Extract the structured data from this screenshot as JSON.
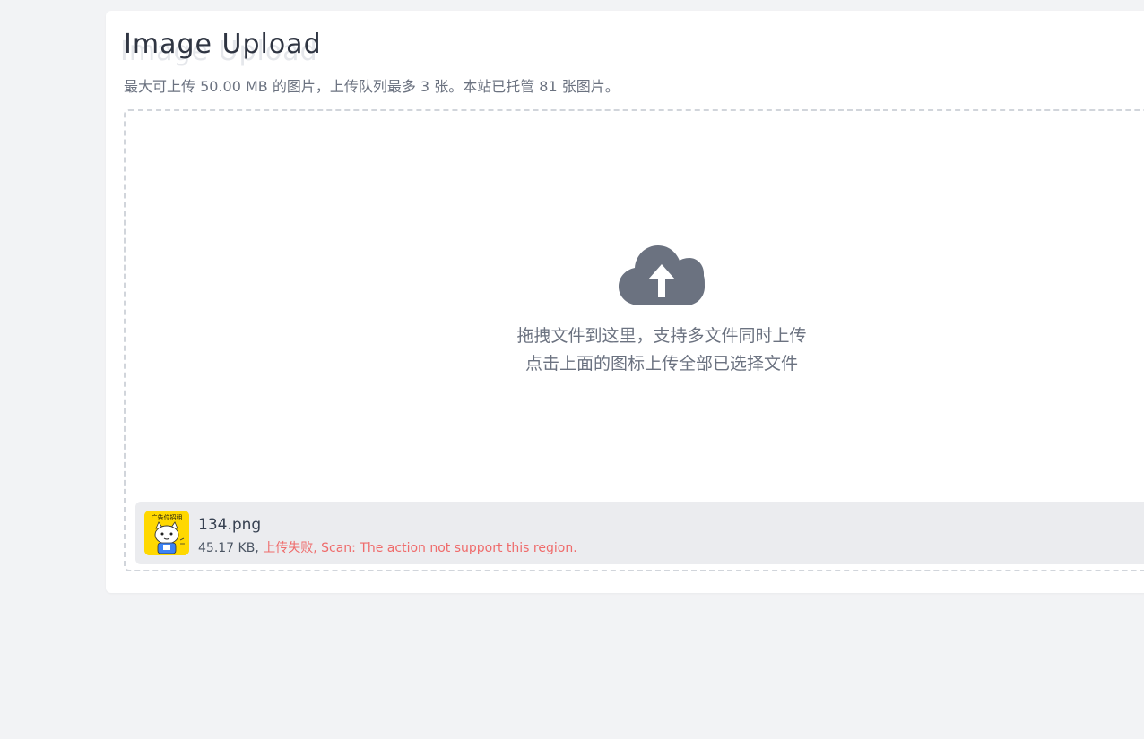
{
  "page": {
    "title": "Image Upload",
    "subtitle": "最大可上传 50.00 MB 的图片，上传队列最多 3 张。本站已托管 81 张图片。"
  },
  "dropzone": {
    "line1": "拖拽文件到这里，支持多文件同时上传",
    "line2": "点击上面的图标上传全部已选择文件",
    "icon": "cloud-upload-icon"
  },
  "files": [
    {
      "name": "134.png",
      "size": "45.17 KB,",
      "status": "上传失败, Scan: The action not support this region.",
      "thumbnail_text": "广告位招租"
    }
  ],
  "colors": {
    "background": "#f2f3f5",
    "card": "#ffffff",
    "icon": "#6b7280",
    "error": "#ef6b6b",
    "file_item_bg": "#ebecef",
    "thumb_bg": "#ffd800"
  }
}
